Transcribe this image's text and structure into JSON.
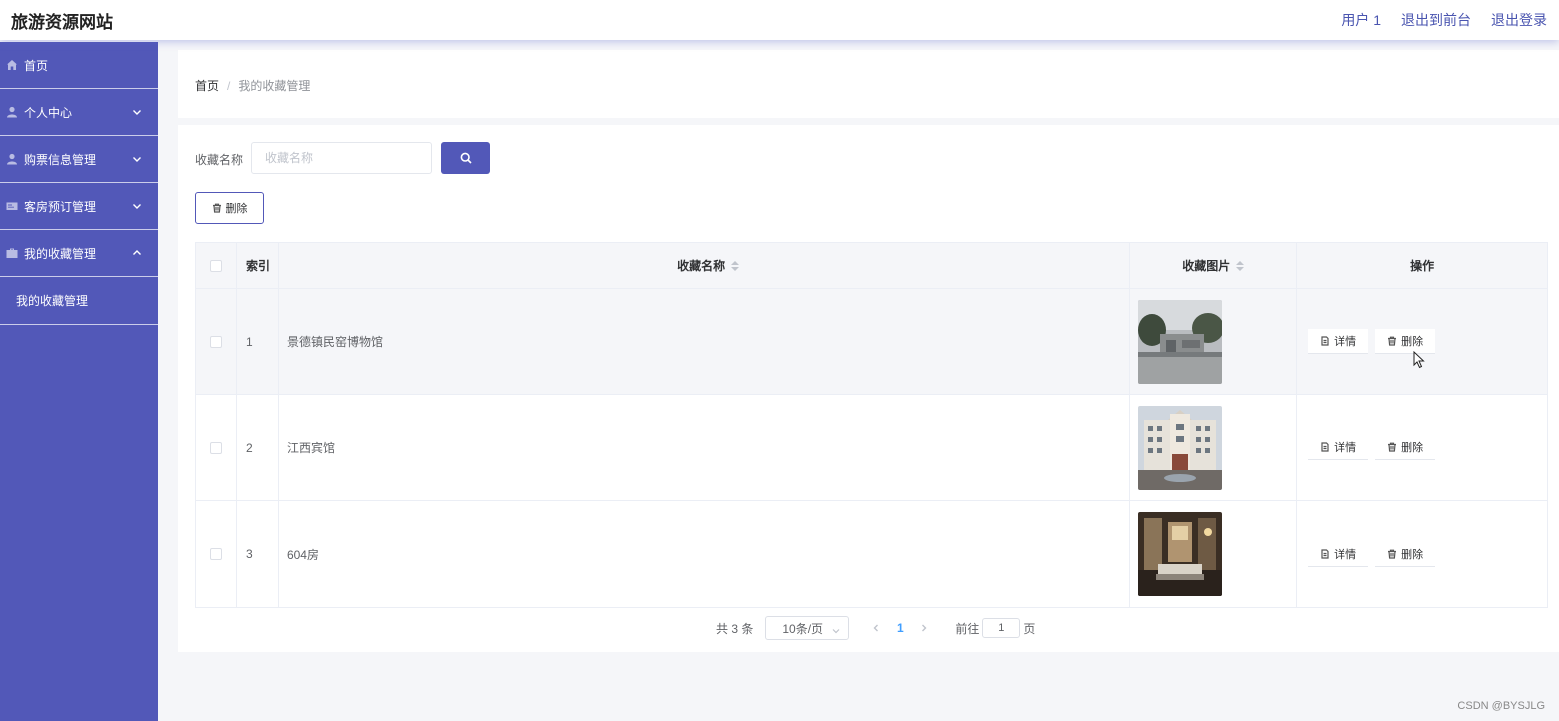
{
  "app": {
    "title": "旅游资源网站"
  },
  "header": {
    "links": [
      "用户 1",
      "退出到前台",
      "退出登录"
    ]
  },
  "sidebar": {
    "items": [
      {
        "label": "首页",
        "icon": "home-icon"
      },
      {
        "label": "个人中心",
        "icon": "user-icon",
        "chevron": "chevron-down-icon"
      },
      {
        "label": "购票信息管理",
        "icon": "user-icon",
        "chevron": "chevron-down-icon"
      },
      {
        "label": "客房预订管理",
        "icon": "card-icon",
        "chevron": "chevron-down-icon"
      },
      {
        "label": "我的收藏管理",
        "icon": "briefcase-icon",
        "chevron": "chevron-up-icon"
      }
    ],
    "submenu": {
      "label": "我的收藏管理"
    }
  },
  "breadcrumb": {
    "home": "首页",
    "separator": "/",
    "current": "我的收藏管理"
  },
  "search": {
    "label": "收藏名称",
    "placeholder": "收藏名称",
    "value": "",
    "button_icon": "search-icon"
  },
  "toolbar": {
    "delete_label": "删除"
  },
  "table": {
    "headers": {
      "index": "索引",
      "name": "收藏名称",
      "image": "收藏图片",
      "ops": "操作"
    },
    "rows": [
      {
        "index": "1",
        "name": "景德镇民窑博物馆",
        "image_desc": "museum-photo",
        "detail": "详情",
        "delete": "删除"
      },
      {
        "index": "2",
        "name": "江西宾馆",
        "image_desc": "hotel-photo",
        "detail": "详情",
        "delete": "删除"
      },
      {
        "index": "3",
        "name": "604房",
        "image_desc": "room-photo",
        "detail": "详情",
        "delete": "删除"
      }
    ]
  },
  "pagination": {
    "total": "共 3 条",
    "page_size": "10条/页",
    "current_page": "1",
    "goto_prefix": "前往",
    "goto_value": "1",
    "goto_suffix": "页"
  },
  "watermark": "CSDN @BYSJLG",
  "colors": {
    "accent": "#5258b8",
    "page_bg": "#f5f6f9"
  }
}
